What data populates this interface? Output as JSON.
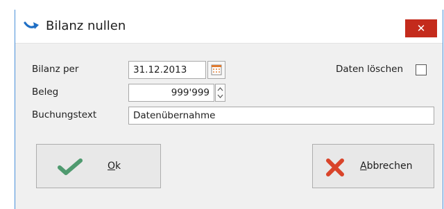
{
  "window": {
    "title": "Bilanz nullen",
    "close_symbol": "✕"
  },
  "form": {
    "bilanz_per_label": "Bilanz per",
    "bilanz_per_value": "31.12.2013",
    "beleg_label": "Beleg",
    "beleg_value": "999'999",
    "buchungstext_label": "Buchungstext",
    "buchungstext_value": "Datenübernahme",
    "daten_loeschen_label": "Daten löschen",
    "daten_loeschen_checked": false
  },
  "buttons": {
    "ok_mnemonic": "O",
    "ok_rest": "k",
    "cancel_mnemonic": "A",
    "cancel_rest": "bbrechen"
  },
  "icons": {
    "title": "arrow-icon",
    "calendar": "calendar-icon",
    "spin": "spinner-arrows-icon",
    "ok": "checkmark-icon",
    "cancel": "cross-icon"
  },
  "colors": {
    "close_button": "#c42b1c",
    "ok_check": "#4f9a6f",
    "cancel_cross": "#d9442a",
    "title_arrow": "#1f6fc5",
    "window_border": "#4a90d9"
  }
}
